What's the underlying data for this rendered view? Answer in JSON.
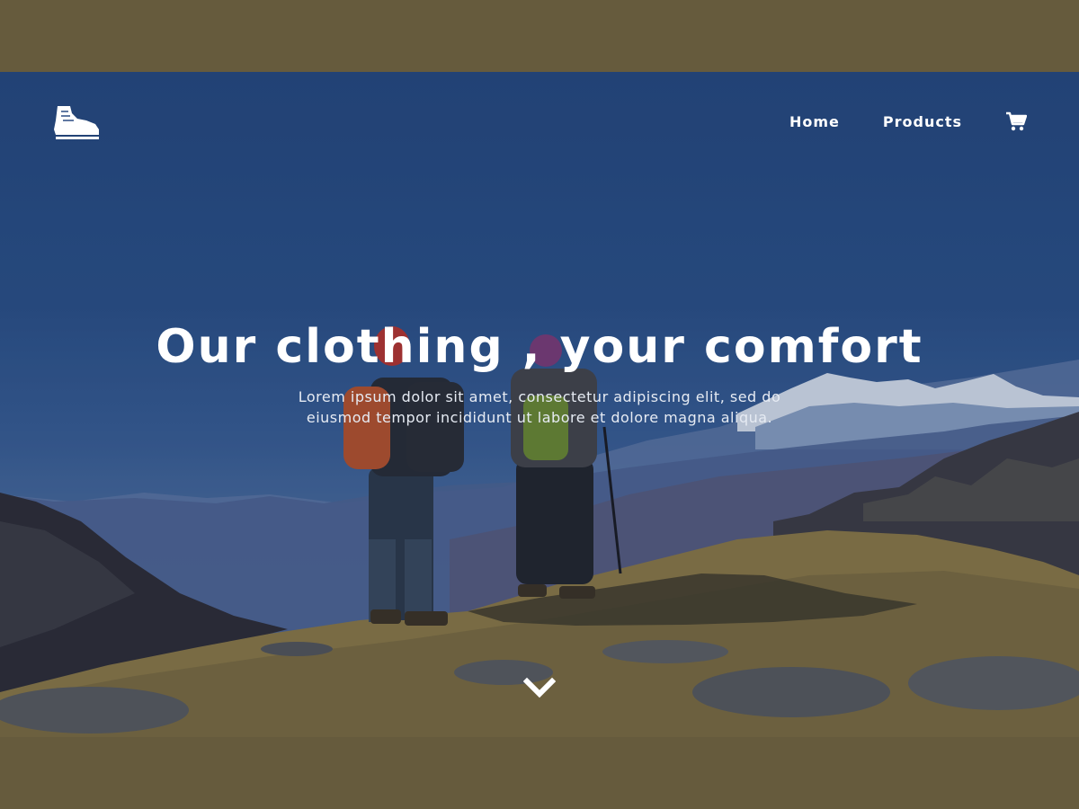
{
  "nav": {
    "logo_icon": "hiking-boot-icon",
    "links": [
      {
        "label": "Home"
      },
      {
        "label": "Products"
      }
    ],
    "cart_icon": "shopping-cart-icon"
  },
  "hero": {
    "headline": "Our clothing , your comfort",
    "subtext": "Lorem ipsum dolor sit amet, consectetur adipiscing elit, sed do eiusmod tempor incididunt ut labore et dolore magna aliqua.",
    "scroll_icon": "chevron-down-icon"
  },
  "colors": {
    "frame": "#665b3d",
    "sky": "#2c5188",
    "text": "#ffffff"
  }
}
